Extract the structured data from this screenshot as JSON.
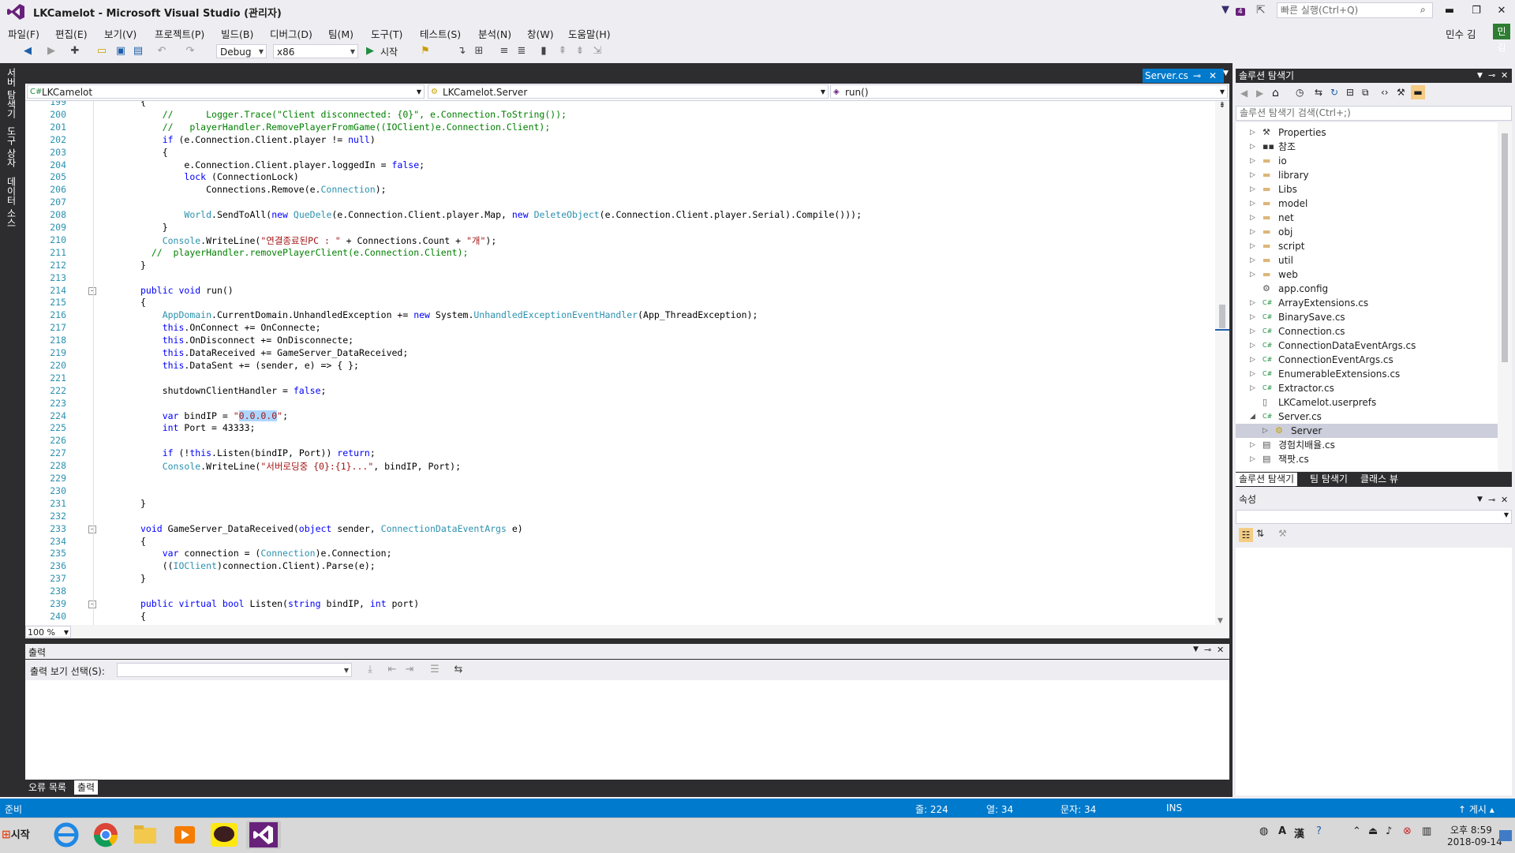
{
  "window": {
    "title": "LKCamelot - Microsoft Visual Studio (관리자)",
    "quick_launch_placeholder": "빠른 실행(Ctrl+Q)",
    "notification_count": "4",
    "user_name": "민수 김",
    "user_badge": "민김",
    "min": "▬",
    "max": "❐",
    "close": "✕"
  },
  "menu": [
    "파일(F)",
    "편집(E)",
    "보기(V)",
    "프로젝트(P)",
    "빌드(B)",
    "디버그(D)",
    "팀(M)",
    "도구(T)",
    "테스트(S)",
    "분석(N)",
    "창(W)",
    "도움말(H)"
  ],
  "toolbar": {
    "config": "Debug",
    "platform": "x86",
    "start_label": "시작"
  },
  "left_dock": [
    "서버 탐색기",
    "도구 상자",
    "데이터 소스"
  ],
  "editor": {
    "tab": "Server.cs",
    "nav_project": "LKCamelot",
    "nav_class": "LKCamelot.Server",
    "nav_member": "run()",
    "zoom": "100 %",
    "lines": [
      {
        "n": "199",
        "code": "{"
      },
      {
        "n": "200",
        "code": "    //      Logger.Trace(\"Client disconnected: {0}\", e.Connection.ToString());"
      },
      {
        "n": "201",
        "code": "    //   playerHandler.RemovePlayerFromGame((IOClient)e.Connection.Client);"
      },
      {
        "n": "202",
        "code": "    if (e.Connection.Client.player != null)"
      },
      {
        "n": "203",
        "code": "    {"
      },
      {
        "n": "204",
        "code": "        e.Connection.Client.player.loggedIn = false;"
      },
      {
        "n": "205",
        "code": "        lock (ConnectionLock)"
      },
      {
        "n": "206",
        "code": "            Connections.Remove(e.Connection);"
      },
      {
        "n": "207",
        "code": ""
      },
      {
        "n": "208",
        "code": "        World.SendToAll(new QueDele(e.Connection.Client.player.Map, new DeleteObject(e.Connection.Client.player.Serial).Compile()));"
      },
      {
        "n": "209",
        "code": "    }"
      },
      {
        "n": "210",
        "code": "    Console.WriteLine(\"연결종료된PC : \" + Connections.Count + \"개\");"
      },
      {
        "n": "211",
        "code": "  //  playerHandler.removePlayerClient(e.Connection.Client);"
      },
      {
        "n": "212",
        "code": "}"
      },
      {
        "n": "213",
        "code": ""
      },
      {
        "n": "214",
        "code": "public void run()"
      },
      {
        "n": "215",
        "code": "{"
      },
      {
        "n": "216",
        "code": "    AppDomain.CurrentDomain.UnhandledException += new System.UnhandledExceptionEventHandler(App_ThreadException);"
      },
      {
        "n": "217",
        "code": "    this.OnConnect += OnConnecte;"
      },
      {
        "n": "218",
        "code": "    this.OnDisconnect += OnDisconnecte;"
      },
      {
        "n": "219",
        "code": "    this.DataReceived += GameServer_DataReceived;"
      },
      {
        "n": "220",
        "code": "    this.DataSent += (sender, e) => { };"
      },
      {
        "n": "221",
        "code": ""
      },
      {
        "n": "222",
        "code": "    shutdownClientHandler = false;"
      },
      {
        "n": "223",
        "code": ""
      },
      {
        "n": "224",
        "code": "    var bindIP = \"0.0.0.0\";"
      },
      {
        "n": "225",
        "code": "    int Port = 43333;"
      },
      {
        "n": "226",
        "code": ""
      },
      {
        "n": "227",
        "code": "    if (!this.Listen(bindIP, Port)) return;"
      },
      {
        "n": "228",
        "code": "    Console.WriteLine(\"서버로딩중 {0}:{1}...\", bindIP, Port);"
      },
      {
        "n": "229",
        "code": ""
      },
      {
        "n": "230",
        "code": ""
      },
      {
        "n": "231",
        "code": "}"
      },
      {
        "n": "232",
        "code": ""
      },
      {
        "n": "233",
        "code": "void GameServer_DataReceived(object sender, ConnectionDataEventArgs e)"
      },
      {
        "n": "234",
        "code": "{"
      },
      {
        "n": "235",
        "code": "    var connection = (Connection)e.Connection;"
      },
      {
        "n": "236",
        "code": "    ((IOClient)connection.Client).Parse(e);"
      },
      {
        "n": "237",
        "code": "}"
      },
      {
        "n": "238",
        "code": ""
      },
      {
        "n": "239",
        "code": "public virtual bool Listen(string bindIP, int port)"
      },
      {
        "n": "240",
        "code": "{"
      }
    ]
  },
  "output": {
    "title": "출력",
    "show_from_label": "출력 보기 선택(S):",
    "tabs": [
      "오류 목록",
      "출력"
    ]
  },
  "solution_explorer": {
    "title": "솔루션 탐색기",
    "search_placeholder": "솔루션 탐색기 검색(Ctrl+;)",
    "items": [
      {
        "label": "Properties",
        "icon": "wrench-icon",
        "level": 1,
        "arrow": "▷"
      },
      {
        "label": "참조",
        "icon": "references-icon",
        "level": 1,
        "arrow": "▷"
      },
      {
        "label": "io",
        "icon": "folder-icon",
        "level": 1,
        "arrow": "▷"
      },
      {
        "label": "library",
        "icon": "folder-icon",
        "level": 1,
        "arrow": "▷"
      },
      {
        "label": "Libs",
        "icon": "folder-icon",
        "level": 1,
        "arrow": "▷"
      },
      {
        "label": "model",
        "icon": "folder-icon",
        "level": 1,
        "arrow": "▷"
      },
      {
        "label": "net",
        "icon": "folder-icon",
        "level": 1,
        "arrow": "▷"
      },
      {
        "label": "obj",
        "icon": "folder-icon",
        "level": 1,
        "arrow": "▷"
      },
      {
        "label": "script",
        "icon": "folder-icon",
        "level": 1,
        "arrow": "▷"
      },
      {
        "label": "util",
        "icon": "folder-icon",
        "level": 1,
        "arrow": "▷"
      },
      {
        "label": "web",
        "icon": "folder-icon",
        "level": 1,
        "arrow": "▷"
      },
      {
        "label": "app.config",
        "icon": "config-file-icon",
        "level": 1,
        "arrow": ""
      },
      {
        "label": "ArrayExtensions.cs",
        "icon": "csharp-file-icon",
        "level": 1,
        "arrow": "▷"
      },
      {
        "label": "BinarySave.cs",
        "icon": "csharp-file-icon",
        "level": 1,
        "arrow": "▷"
      },
      {
        "label": "Connection.cs",
        "icon": "csharp-file-icon",
        "level": 1,
        "arrow": "▷"
      },
      {
        "label": "ConnectionDataEventArgs.cs",
        "icon": "csharp-file-icon",
        "level": 1,
        "arrow": "▷"
      },
      {
        "label": "ConnectionEventArgs.cs",
        "icon": "csharp-file-icon",
        "level": 1,
        "arrow": "▷"
      },
      {
        "label": "EnumerableExtensions.cs",
        "icon": "csharp-file-icon",
        "level": 1,
        "arrow": "▷"
      },
      {
        "label": "Extractor.cs",
        "icon": "csharp-file-icon",
        "level": 1,
        "arrow": "▷"
      },
      {
        "label": "LKCamelot.userprefs",
        "icon": "file-icon",
        "level": 1,
        "arrow": ""
      },
      {
        "label": "Server.cs",
        "icon": "csharp-file-icon",
        "level": 1,
        "arrow": "◢"
      },
      {
        "label": "Server",
        "icon": "class-icon",
        "level": 2,
        "arrow": "▷"
      },
      {
        "label": "경험치배율.cs",
        "icon": "form-file-icon",
        "level": 1,
        "arrow": "▷"
      },
      {
        "label": "잭팟.cs",
        "icon": "form-file-icon",
        "level": 1,
        "arrow": "▷"
      }
    ],
    "tabs": [
      "솔루션 탐색기",
      "팀 탐색기",
      "클래스 뷰"
    ]
  },
  "properties": {
    "title": "속성"
  },
  "status": {
    "ready": "준비",
    "line": "줄: 224",
    "col": "열: 34",
    "char": "문자: 34",
    "ins": "INS",
    "publish": "↑ 게시 ▴"
  },
  "taskbar": {
    "start": "시작",
    "time": "오후 8:59",
    "date": "2018-09-14"
  },
  "colors": {
    "accent": "#007ACC",
    "vs_purple": "#68217A",
    "dark_chrome": "#2D2D30"
  }
}
